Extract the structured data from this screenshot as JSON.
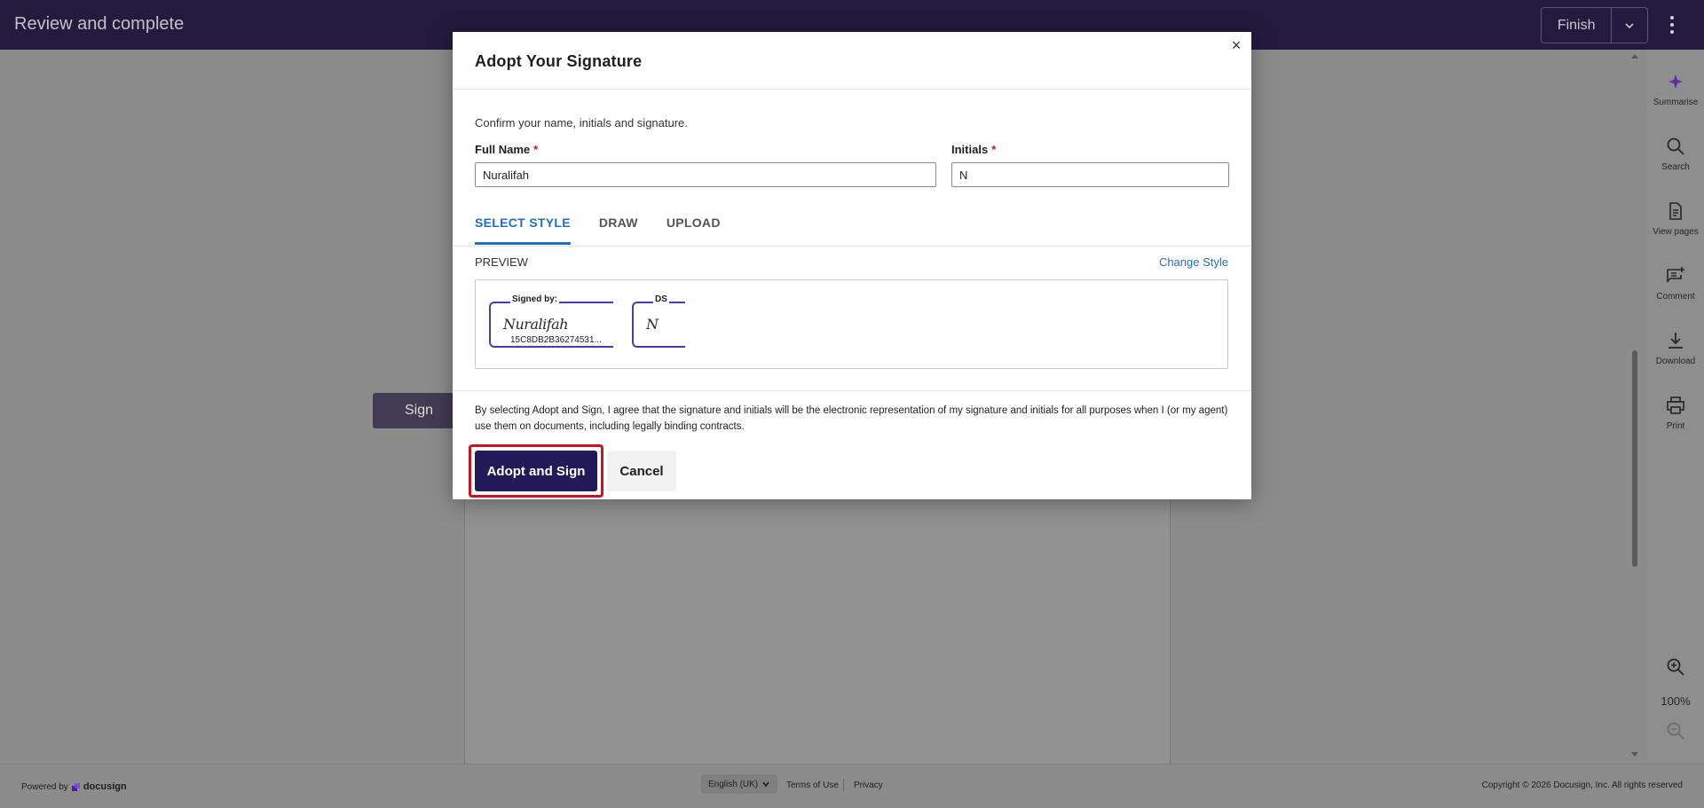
{
  "header": {
    "title": "Review and complete",
    "finish_label": "Finish"
  },
  "document": {
    "sign_tag_label": "Sign"
  },
  "toolbar": {
    "items": [
      {
        "label": "Summarise",
        "icon": "sparkle-icon"
      },
      {
        "label": "Search",
        "icon": "search-icon"
      },
      {
        "label": "View pages",
        "icon": "pages-icon"
      },
      {
        "label": "Comment",
        "icon": "comment-icon"
      },
      {
        "label": "Download",
        "icon": "download-icon"
      },
      {
        "label": "Print",
        "icon": "print-icon"
      }
    ],
    "zoom_level": "100%"
  },
  "modal": {
    "title": "Adopt Your Signature",
    "close_label": "×",
    "instructions": "Confirm your name, initials and signature.",
    "full_name_label": "Full Name",
    "full_name_value": "Nuralifah",
    "initials_label": "Initials",
    "initials_value": "N",
    "required_marker": "*",
    "tabs": [
      {
        "label": "SELECT STYLE",
        "active": true
      },
      {
        "label": "DRAW",
        "active": false
      },
      {
        "label": "UPLOAD",
        "active": false
      }
    ],
    "preview_label": "PREVIEW",
    "change_style_label": "Change Style",
    "signature_block": {
      "caption": "Signed by:",
      "script": "Nuralifah",
      "id": "15C8DB2B36274531..."
    },
    "initials_block": {
      "caption": "DS",
      "script": "N"
    },
    "legal_text": "By selecting Adopt and Sign, I agree that the signature and initials will be the electronic representation of my signature and initials for all purposes when I (or my agent) use them on documents, including legally binding contracts.",
    "adopt_button": "Adopt and Sign",
    "cancel_button": "Cancel"
  },
  "footer": {
    "powered_by": "Powered by",
    "brand": "docusign",
    "language": "English (UK)",
    "terms": "Terms of Use",
    "privacy": "Privacy",
    "copyright": "Copyright © 2026 Docusign, Inc. All rights reserved"
  },
  "colors": {
    "header_bg": "#231a3d",
    "primary_button": "#231a5a",
    "link": "#1f6fc5",
    "highlight_outline": "#d0101c",
    "required": "#c8102e"
  }
}
